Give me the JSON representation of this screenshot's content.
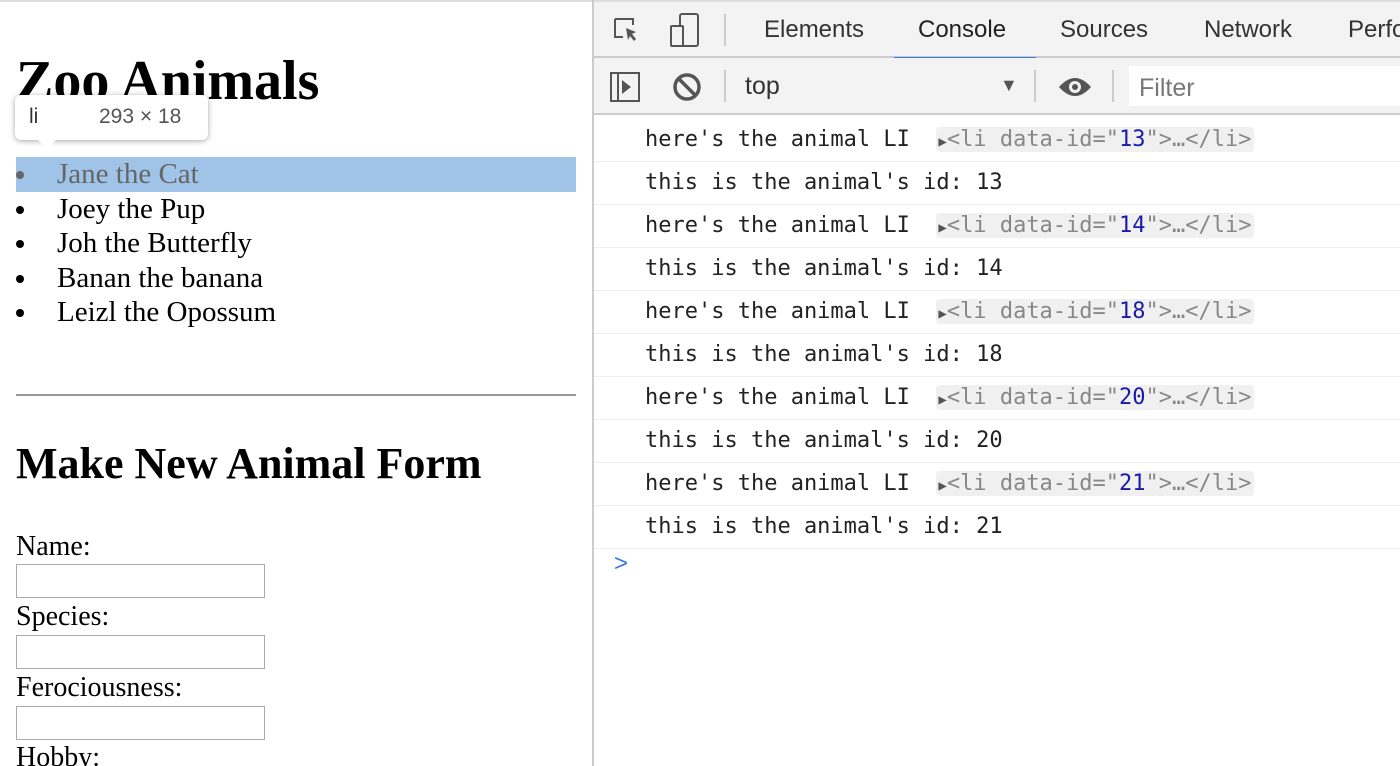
{
  "page": {
    "title": "Zoo Animals",
    "animals": [
      "Jane the Cat",
      "Joey the Pup",
      "Joh the Butterfly",
      "Banan the banana",
      "Leizl the Opossum"
    ],
    "form_title": "Make New Animal Form",
    "fields": [
      "Name:",
      "Species:",
      "Ferociousness:",
      "Hobby:"
    ]
  },
  "tooltip": {
    "tag": "li",
    "size": "293 × 18"
  },
  "devtools": {
    "tabs": [
      "Elements",
      "Console",
      "Sources",
      "Network",
      "Perfo"
    ],
    "active_tab": "Console",
    "context": "top",
    "filter_placeholder": "Filter",
    "logs": [
      {
        "label": "here's the animal LI",
        "id": "13",
        "result": "this is the animal's id: 13"
      },
      {
        "label": "here's the animal LI",
        "id": "14",
        "result": "this is the animal's id: 14"
      },
      {
        "label": "here's the animal LI",
        "id": "18",
        "result": "this is the animal's id: 18"
      },
      {
        "label": "here's the animal LI",
        "id": "20",
        "result": "this is the animal's id: 20"
      },
      {
        "label": "here's the animal LI",
        "id": "21",
        "result": "this is the animal's id: 21"
      }
    ],
    "node_prefix": "<li data-id=\"",
    "node_suffix": "\">…</li>",
    "prompt": ">"
  }
}
